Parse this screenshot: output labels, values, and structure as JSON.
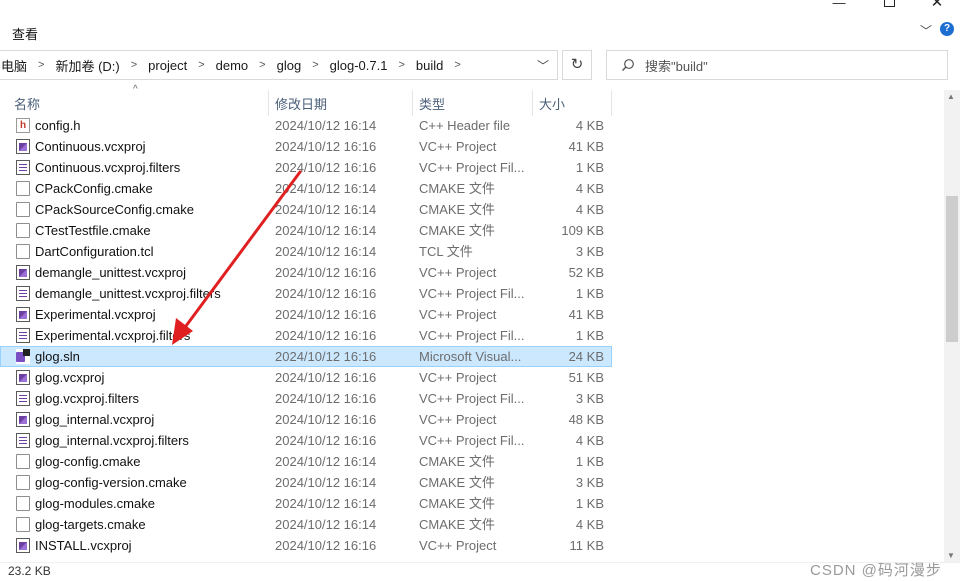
{
  "window": {
    "min_glyph": "—",
    "close_glyph": "✕"
  },
  "ribbon": {
    "view_tab": "查看",
    "expand_glyph": "﹀",
    "help_glyph": "?"
  },
  "breadcrumb": {
    "items": [
      "电脑",
      "新加卷 (D:)",
      "project",
      "demo",
      "glog",
      "glog-0.7.1",
      "build"
    ],
    "separator": ">",
    "dropdown_glyph": "﹀"
  },
  "refresh_glyph": "↻",
  "search": {
    "placeholder": "搜索\"build\""
  },
  "columns": {
    "name": "名称",
    "date": "修改日期",
    "type": "类型",
    "size": "大小"
  },
  "sort_indicator": "^",
  "files": [
    {
      "icon": "header-file-icon",
      "name": "config.h",
      "date": "2024/10/12 16:14",
      "type": "C++ Header file",
      "size": "4 KB",
      "selected": false
    },
    {
      "icon": "vcxproj-icon",
      "name": "Continuous.vcxproj",
      "date": "2024/10/12 16:16",
      "type": "VC++ Project",
      "size": "41 KB",
      "selected": false
    },
    {
      "icon": "filters-icon",
      "name": "Continuous.vcxproj.filters",
      "date": "2024/10/12 16:16",
      "type": "VC++ Project Fil...",
      "size": "1 KB",
      "selected": false
    },
    {
      "icon": "cmake-file-icon",
      "name": "CPackConfig.cmake",
      "date": "2024/10/12 16:14",
      "type": "CMAKE 文件",
      "size": "4 KB",
      "selected": false
    },
    {
      "icon": "cmake-file-icon",
      "name": "CPackSourceConfig.cmake",
      "date": "2024/10/12 16:14",
      "type": "CMAKE 文件",
      "size": "4 KB",
      "selected": false
    },
    {
      "icon": "cmake-file-icon",
      "name": "CTestTestfile.cmake",
      "date": "2024/10/12 16:14",
      "type": "CMAKE 文件",
      "size": "109 KB",
      "selected": false
    },
    {
      "icon": "tcl-file-icon",
      "name": "DartConfiguration.tcl",
      "date": "2024/10/12 16:14",
      "type": "TCL 文件",
      "size": "3 KB",
      "selected": false
    },
    {
      "icon": "vcxproj-icon",
      "name": "demangle_unittest.vcxproj",
      "date": "2024/10/12 16:16",
      "type": "VC++ Project",
      "size": "52 KB",
      "selected": false
    },
    {
      "icon": "filters-icon",
      "name": "demangle_unittest.vcxproj.filters",
      "date": "2024/10/12 16:16",
      "type": "VC++ Project Fil...",
      "size": "1 KB",
      "selected": false
    },
    {
      "icon": "vcxproj-icon",
      "name": "Experimental.vcxproj",
      "date": "2024/10/12 16:16",
      "type": "VC++ Project",
      "size": "41 KB",
      "selected": false
    },
    {
      "icon": "filters-icon",
      "name": "Experimental.vcxproj.filters",
      "date": "2024/10/12 16:16",
      "type": "VC++ Project Fil...",
      "size": "1 KB",
      "selected": false
    },
    {
      "icon": "sln-icon",
      "name": "glog.sln",
      "date": "2024/10/12 16:16",
      "type": "Microsoft Visual...",
      "size": "24 KB",
      "selected": true
    },
    {
      "icon": "vcxproj-icon",
      "name": "glog.vcxproj",
      "date": "2024/10/12 16:16",
      "type": "VC++ Project",
      "size": "51 KB",
      "selected": false
    },
    {
      "icon": "filters-icon",
      "name": "glog.vcxproj.filters",
      "date": "2024/10/12 16:16",
      "type": "VC++ Project Fil...",
      "size": "3 KB",
      "selected": false
    },
    {
      "icon": "vcxproj-icon",
      "name": "glog_internal.vcxproj",
      "date": "2024/10/12 16:16",
      "type": "VC++ Project",
      "size": "48 KB",
      "selected": false
    },
    {
      "icon": "filters-icon",
      "name": "glog_internal.vcxproj.filters",
      "date": "2024/10/12 16:16",
      "type": "VC++ Project Fil...",
      "size": "4 KB",
      "selected": false
    },
    {
      "icon": "cmake-file-icon",
      "name": "glog-config.cmake",
      "date": "2024/10/12 16:14",
      "type": "CMAKE 文件",
      "size": "1 KB",
      "selected": false
    },
    {
      "icon": "cmake-file-icon",
      "name": "glog-config-version.cmake",
      "date": "2024/10/12 16:14",
      "type": "CMAKE 文件",
      "size": "3 KB",
      "selected": false
    },
    {
      "icon": "cmake-file-icon",
      "name": "glog-modules.cmake",
      "date": "2024/10/12 16:14",
      "type": "CMAKE 文件",
      "size": "1 KB",
      "selected": false
    },
    {
      "icon": "cmake-file-icon",
      "name": "glog-targets.cmake",
      "date": "2024/10/12 16:14",
      "type": "CMAKE 文件",
      "size": "4 KB",
      "selected": false
    },
    {
      "icon": "vcxproj-icon",
      "name": "INSTALL.vcxproj",
      "date": "2024/10/12 16:16",
      "type": "VC++ Project",
      "size": "11 KB",
      "selected": false
    }
  ],
  "status": {
    "selected_size": "23.2 KB",
    "watermark": "CSDN @码河漫步"
  },
  "colors": {
    "selection_bg": "#cce8ff",
    "selection_border": "#99d1ff",
    "annotation_arrow": "#e02020",
    "header_text": "#4c607a"
  }
}
